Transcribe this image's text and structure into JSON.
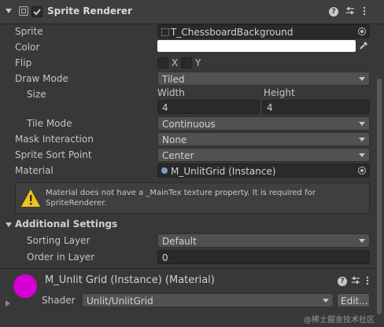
{
  "header": {
    "title": "Sprite Renderer"
  },
  "sprite": {
    "label": "Sprite",
    "value": "T_ChessboardBackground"
  },
  "color": {
    "label": "Color",
    "value": "#ffffff"
  },
  "flip": {
    "label": "Flip",
    "x": "X",
    "y": "Y"
  },
  "draw_mode": {
    "label": "Draw Mode",
    "value": "Tiled"
  },
  "size": {
    "label": "Size",
    "width_label": "Width",
    "height_label": "Height",
    "width": "4",
    "height": "4"
  },
  "tile_mode": {
    "label": "Tile Mode",
    "value": "Continuous"
  },
  "mask": {
    "label": "Mask Interaction",
    "value": "None"
  },
  "sort_point": {
    "label": "Sprite Sort Point",
    "value": "Center"
  },
  "material": {
    "label": "Material",
    "value": "M_UnlitGrid (Instance)"
  },
  "warning": {
    "text": "Material does not have a _MainTex texture property. It is required for SpriteRenderer."
  },
  "additional": {
    "title": "Additional Settings"
  },
  "sorting_layer": {
    "label": "Sorting Layer",
    "value": "Default"
  },
  "order": {
    "label": "Order in Layer",
    "value": "0"
  },
  "material_panel": {
    "title": "M_Unlit Grid (Instance) (Material)",
    "shader_label": "Shader",
    "shader_value": "Unlit/UnlitGrid",
    "edit_label": "Edit..."
  },
  "watermark": "@稀土掘金技术社区",
  "colors": {
    "accent_purple": "#d400d4",
    "warning_yellow": "#f0c419"
  }
}
